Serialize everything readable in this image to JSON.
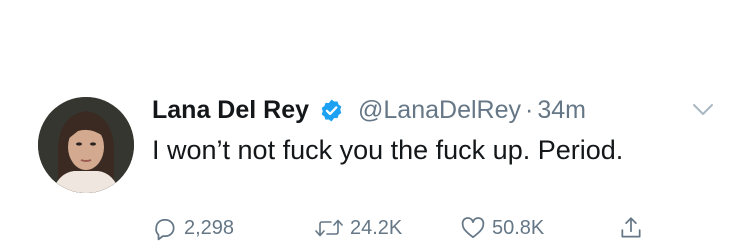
{
  "tweet": {
    "author_name": "Lana Del Rey",
    "handle": "@LanaDelRey",
    "separator": "·",
    "time": "34m",
    "text": "I won’t not fuck you the fuck up. Period.",
    "verified": true,
    "icons": {
      "verified": "verified-badge-icon",
      "menu": "chevron-down-icon",
      "reply": "reply-icon",
      "retweet": "retweet-icon",
      "like": "heart-icon",
      "share": "share-icon"
    }
  },
  "actions": {
    "reply_count": "2,298",
    "retweet_count": "24.2K",
    "like_count": "50.8K"
  },
  "colors": {
    "verified": "#1da1f2",
    "text": "#14171a",
    "muted": "#657786"
  }
}
